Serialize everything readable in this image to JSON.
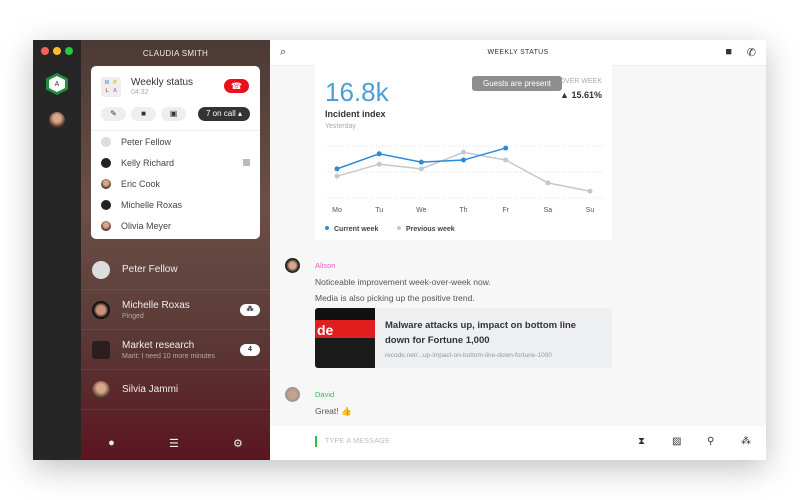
{
  "window": {
    "traffic_colors": [
      "#fc5f57",
      "#fdbc2e",
      "#28c840"
    ]
  },
  "rail": {
    "workspace_letter": "A"
  },
  "sidebar": {
    "user": "CLAUDIA SMITH",
    "call": {
      "title": "Weekly status",
      "time": "04:32",
      "logo": [
        "M",
        "P",
        "L",
        "A"
      ],
      "on_call": "7 on call",
      "participants": [
        "Peter Fellow",
        "Kelly Richard",
        "Eric Cook",
        "Michelle Roxas",
        "Olivia Meyer"
      ]
    },
    "conversations": [
      {
        "name": "Peter Fellow",
        "sub": "",
        "badge": ""
      },
      {
        "name": "Michelle Roxas",
        "sub": "Pinged",
        "badge": "⁂"
      },
      {
        "name": "Market research",
        "sub": "Marit: I need 10 more minutes",
        "badge": "4"
      },
      {
        "name": "Silvia Jammi",
        "sub": "",
        "badge": ""
      }
    ]
  },
  "header": {
    "title": "WEEKLY STATUS"
  },
  "chart_card": {
    "value": "16.8k",
    "label": "Incident index",
    "period": "Yesterday",
    "change_label": "OVER WEEK",
    "change": "15.61%",
    "tooltip": "Guests are present"
  },
  "chart_data": {
    "type": "line",
    "categories": [
      "Mo",
      "Tu",
      "We",
      "Th",
      "Fr",
      "Sa",
      "Su"
    ],
    "ylim": [
      0,
      100
    ],
    "grid": true,
    "legend": "bottom-left",
    "series": [
      {
        "name": "Current week",
        "color": "#2d8ad6",
        "values": [
          56,
          85,
          69,
          73,
          96,
          null,
          null
        ]
      },
      {
        "name": "Previous week",
        "color": "#c3c8ce",
        "values": [
          42,
          65,
          56,
          88,
          73,
          29,
          13
        ]
      }
    ]
  },
  "messages": [
    {
      "author": "Alison",
      "color": "#e85fc0",
      "lines": [
        "Noticeable improvement week-over-week now.",
        "Media is also picking up the positive trend."
      ]
    },
    {
      "author": "David",
      "color": "#2fbf4a",
      "lines": [
        "Great! 👍"
      ]
    }
  ],
  "link": {
    "title": "Malware attacks up, impact on bottom line down for Fortune 1,000",
    "url": "recode.net/...up-impact-on-bottom-line-down-fortune-1000",
    "thumb_text": "de"
  },
  "composer": {
    "placeholder": "TYPE A MESSAGE"
  }
}
